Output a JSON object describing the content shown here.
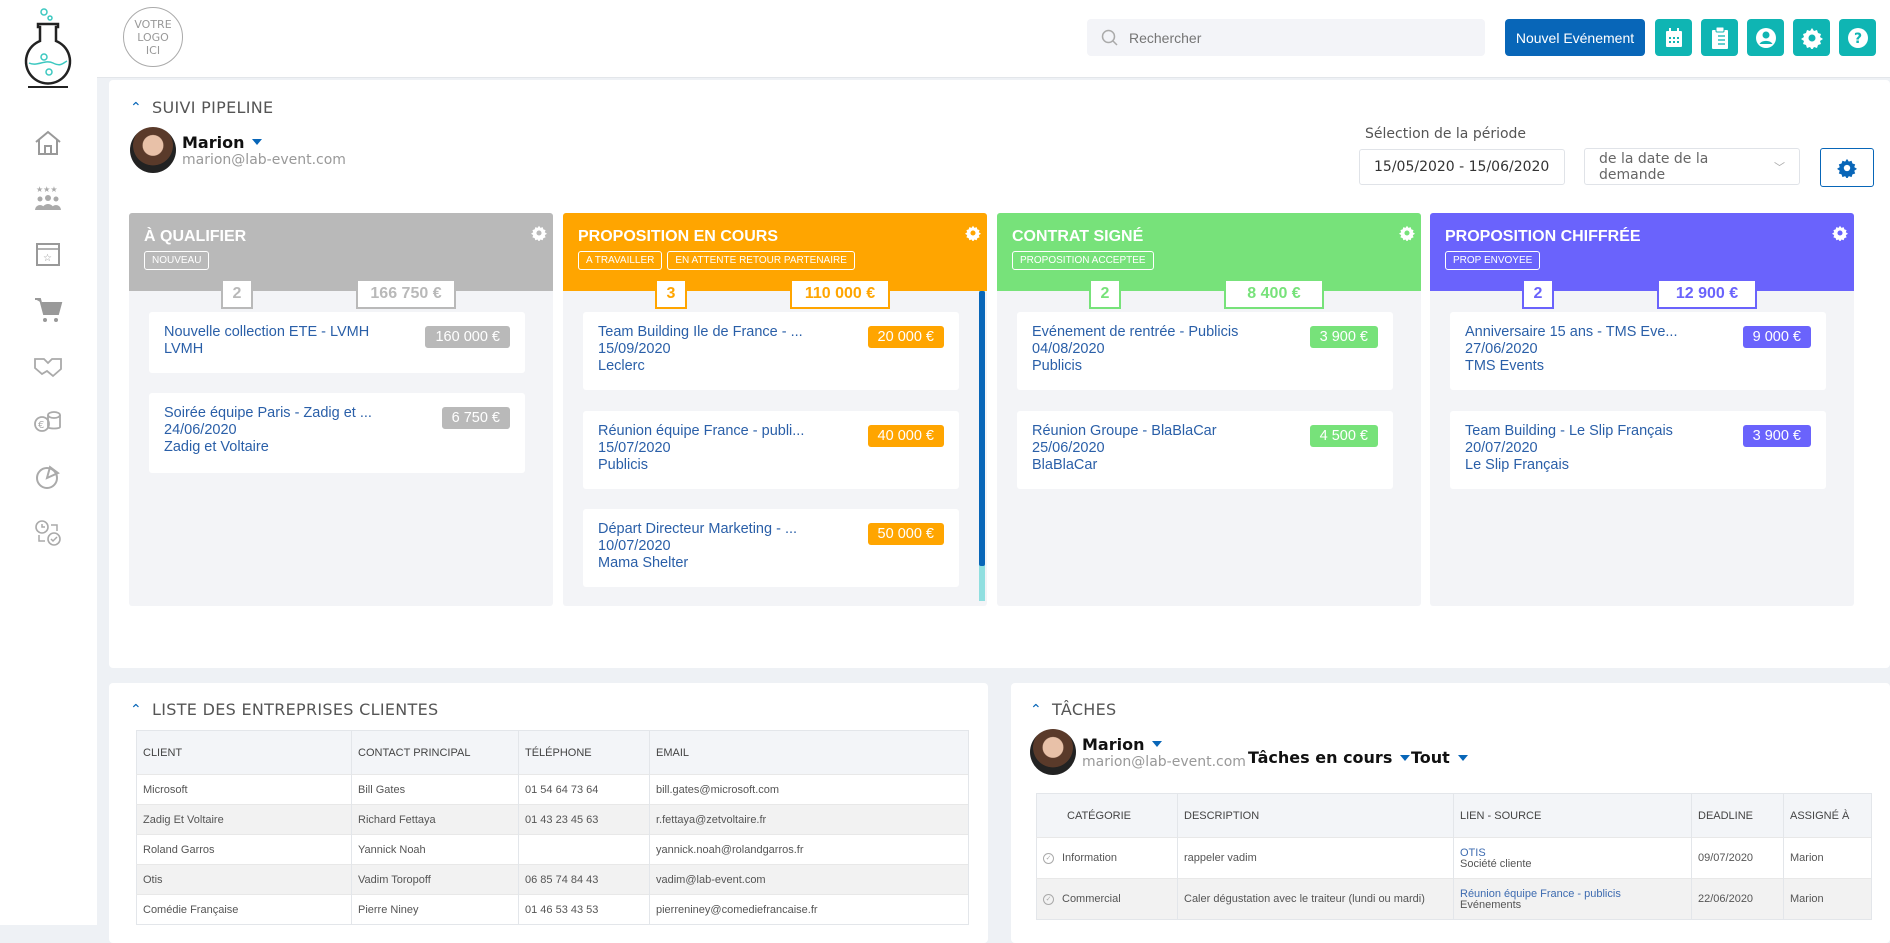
{
  "topbar": {
    "brand_logo_lines": [
      "VOTRE",
      "LOGO",
      "ICI"
    ],
    "search_placeholder": "Rechercher",
    "new_event_label": "Nouvel Evénement",
    "icons": [
      "calendar-icon",
      "clipboard-icon",
      "user-circle-icon",
      "gear-icon",
      "help-icon"
    ]
  },
  "sidebar": {
    "items": [
      "home",
      "clients",
      "events-calendar",
      "shop",
      "partners",
      "finance",
      "stats",
      "tasks"
    ]
  },
  "pipeline": {
    "title": "SUIVI PIPELINE",
    "user": {
      "name": "Marion",
      "email": "marion@lab-event.com"
    },
    "period_label": "Sélection de la période",
    "period_value": "15/05/2020 - 15/06/2020",
    "period_type": "de la date de la demande",
    "colors": {
      "qualifier": "#b9b9b9",
      "en_cours": "#ffa500",
      "signe": "#77e27a",
      "chiffree": "#6a63fc",
      "card_link": "#2a5fa8"
    },
    "columns": [
      {
        "title": "À QUALIFIER",
        "tags": [
          "NOUVEAU"
        ],
        "count": "2",
        "total": "166 750 €",
        "color": "#b9b9b9",
        "cards": [
          {
            "title": "Nouvelle collection ETE - LVMH",
            "date": "",
            "client": "LVMH",
            "amount": "160 000 €"
          },
          {
            "title": "Soirée équipe Paris - Zadig et ...",
            "date": "24/06/2020",
            "client": "Zadig et Voltaire",
            "amount": "6 750 €"
          }
        ]
      },
      {
        "title": "PROPOSITION EN COURS",
        "tags": [
          "A TRAVAILLER",
          "EN ATTENTE RETOUR PARTENAIRE"
        ],
        "count": "3",
        "total": "110 000 €",
        "color": "#ffa500",
        "cards": [
          {
            "title": "Team Building Ile de France - ...",
            "date": "15/09/2020",
            "client": "Leclerc",
            "amount": "20 000 €"
          },
          {
            "title": "Réunion équipe France - publi...",
            "date": "15/07/2020",
            "client": "Publicis",
            "amount": "40 000 €"
          },
          {
            "title": "Départ Directeur Marketing - ...",
            "date": "10/07/2020",
            "client": "Mama Shelter",
            "amount": "50 000 €"
          }
        ]
      },
      {
        "title": "CONTRAT SIGNÉ",
        "tags": [
          "PROPOSITION ACCEPTEE"
        ],
        "count": "2",
        "total": "8 400 €",
        "color": "#77e27a",
        "cards": [
          {
            "title": "Evénement de rentrée - Publicis",
            "date": "04/08/2020",
            "client": "Publicis",
            "amount": "3 900 €"
          },
          {
            "title": "Réunion Groupe - BlaBlaCar",
            "date": "25/06/2020",
            "client": "BlaBlaCar",
            "amount": "4 500 €"
          }
        ]
      },
      {
        "title": "PROPOSITION CHIFFRÉE",
        "tags": [
          "PROP ENVOYEE"
        ],
        "count": "2",
        "total": "12 900 €",
        "color": "#6a63fc",
        "cards": [
          {
            "title": "Anniversaire 15 ans - TMS Eve...",
            "date": "27/06/2020",
            "client": "TMS Events",
            "amount": "9 000 €"
          },
          {
            "title": "Team Building - Le Slip Français",
            "date": "20/07/2020",
            "client": "Le Slip Français",
            "amount": "3 900 €"
          }
        ]
      }
    ]
  },
  "clients": {
    "title": "LISTE DES ENTREPRISES CLIENTES",
    "headers": [
      "CLIENT",
      "CONTACT PRINCIPAL",
      "TÉLÉPHONE",
      "EMAIL"
    ],
    "rows": [
      [
        "Microsoft",
        "Bill Gates",
        "01 54 64 73 64",
        "bill.gates@microsoft.com"
      ],
      [
        "Zadig Et Voltaire",
        "Richard Fettaya",
        "01 43 23 45 63",
        "r.fettaya@zetvoltaire.fr"
      ],
      [
        "Roland Garros",
        "Yannick Noah",
        "",
        "yannick.noah@rolandgarros.fr"
      ],
      [
        "Otis",
        "Vadim Toropoff",
        "06 85 74 84 43",
        "vadim@lab-event.com"
      ],
      [
        "Comédie Française",
        "Pierre Niney",
        "01 46 53 43 53",
        "pierreniney@comediefrancaise.fr"
      ]
    ]
  },
  "tasks": {
    "title": "TÂCHES",
    "user": {
      "name": "Marion",
      "email": "marion@lab-event.com"
    },
    "filter_status": "Tâches en cours",
    "filter_scope": "Tout",
    "headers": [
      "CATÉGORIE",
      "DESCRIPTION",
      "LIEN - SOURCE",
      "DEADLINE",
      "ASSIGNÉ À"
    ],
    "rows": [
      {
        "category": "Information",
        "description": "rappeler vadim",
        "link": "OTIS",
        "source": "Société cliente",
        "deadline": "09/07/2020",
        "assignee": "Marion"
      },
      {
        "category": "Commercial",
        "description": "Caler dégustation avec le traiteur (lundi ou mardi)",
        "link": "Réunion équipe France - publicis",
        "source": "Evénements",
        "deadline": "22/06/2020",
        "assignee": "Marion"
      }
    ]
  }
}
